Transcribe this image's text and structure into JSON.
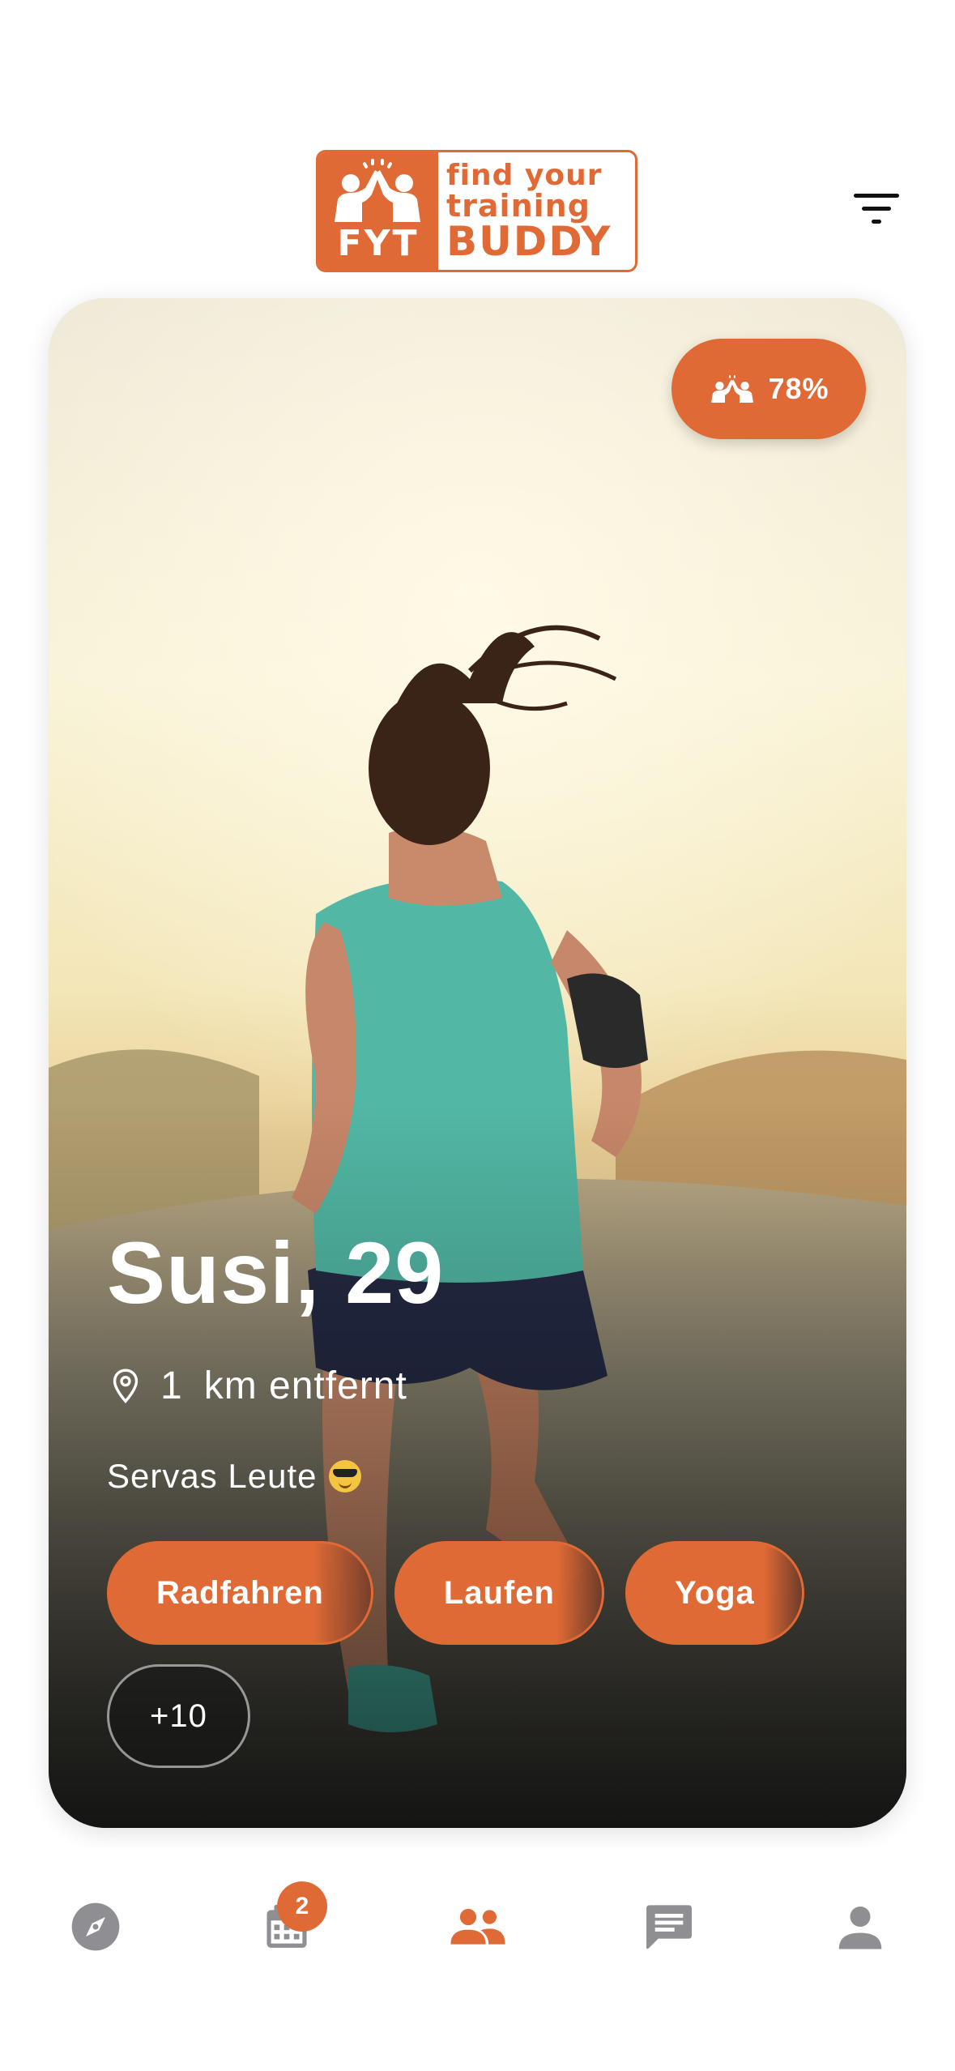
{
  "app": {
    "logo": {
      "line1": "find your",
      "line2": "training",
      "line3": "BUDDY",
      "abbr": "FYT"
    },
    "filter_icon": "filter-icon"
  },
  "profile": {
    "name_age": "Susi, 29",
    "distance_value": "1",
    "distance_unit": "km entfernt",
    "bio": "Servas Leute",
    "bio_emoji": "smiling-face-with-sunglasses",
    "match_percent": "78%",
    "tags": [
      "Radfahren",
      "Laufen",
      "Yoga"
    ],
    "more_tags": "+10"
  },
  "nav": {
    "items": [
      {
        "name": "discover",
        "icon": "compass-icon",
        "active": false
      },
      {
        "name": "calendar",
        "icon": "calendar-icon",
        "active": false,
        "badge": "2"
      },
      {
        "name": "buddies",
        "icon": "people-icon",
        "active": true
      },
      {
        "name": "messages",
        "icon": "chat-icon",
        "active": false
      },
      {
        "name": "profile",
        "icon": "person-icon",
        "active": false
      }
    ]
  },
  "colors": {
    "accent": "#e06a35",
    "inactive_icon": "#8e8e93",
    "text_dark": "#111111"
  }
}
